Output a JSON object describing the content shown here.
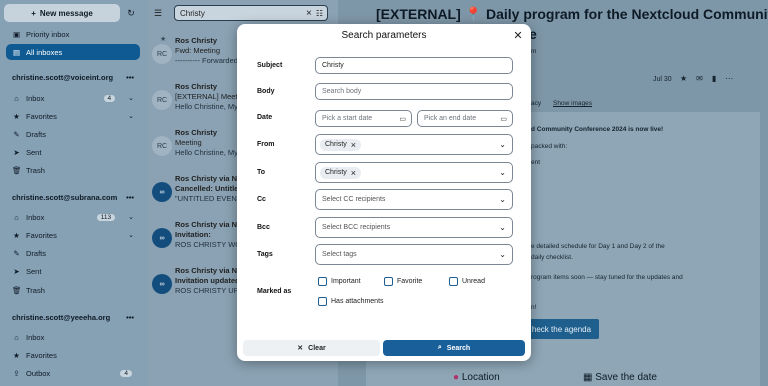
{
  "sidebar": {
    "new_message": "New message",
    "priority_inbox": "Priority inbox",
    "all_inboxes": "All inboxes",
    "accounts": [
      {
        "email": "christine.scott@voiceint.org",
        "folders": [
          {
            "label": "Inbox",
            "count": "4"
          },
          {
            "label": "Favorites"
          },
          {
            "label": "Drafts"
          },
          {
            "label": "Sent"
          },
          {
            "label": "Trash"
          }
        ]
      },
      {
        "email": "christine.scott@subrana.com",
        "folders": [
          {
            "label": "Inbox",
            "count": "113"
          },
          {
            "label": "Favorites"
          },
          {
            "label": "Drafts"
          },
          {
            "label": "Sent"
          },
          {
            "label": "Trash"
          }
        ]
      },
      {
        "email": "christine.scott@yeeeha.org",
        "folders": [
          {
            "label": "Inbox"
          },
          {
            "label": "Favorites"
          },
          {
            "label": "Outbox",
            "count": "4"
          }
        ]
      }
    ]
  },
  "message_list": {
    "search_value": "Christy",
    "messages": [
      {
        "from": "Ros Christy",
        "subject": "Fwd: Meeting",
        "preview": "---------- Forwarded",
        "avatar": "RC"
      },
      {
        "from": "Ros Christy",
        "subject": "[EXTERNAL] Meeting",
        "preview": "Hello Christine, My",
        "avatar": "RC"
      },
      {
        "from": "Ros Christy",
        "subject": "Meeting",
        "preview": "Hello Christine, My",
        "avatar": "RC"
      },
      {
        "from": "Ros Christy via Nex",
        "subject": "Cancelled: Untitled",
        "preview": "\"UNTITLED EVENT\"",
        "avatar": ""
      },
      {
        "from": "Ros Christy via Nex",
        "subject": "Invitation:",
        "preview": "ROS CHRISTY WOU",
        "avatar": ""
      },
      {
        "from": "Ros Christy via Nex",
        "subject": "Invitation updated",
        "preview": "ROS CHRISTY UPDA",
        "avatar": ""
      }
    ]
  },
  "reader": {
    "title_line1": "[EXTERNAL] 📍 Daily program for the Nextcloud Community",
    "title_line2": "e",
    "sender_fragment": "m",
    "date": "Jul 30",
    "privacy_fragment": "acy",
    "show_images": "Show images",
    "body_lines": [
      "d Community Conference 2024 is now live!",
      "packed with:",
      "ent",
      "e detailed schedule for Day 1 and Day 2 of the",
      "daily checklist.",
      "rogram items soon — stay tuned for the updates and",
      "n!"
    ],
    "agenda_button": "heck the agenda",
    "location": "Location",
    "save_the_date": "Save the date"
  },
  "modal": {
    "title": "Search parameters",
    "fields": {
      "subject_label": "Subject",
      "subject_value": "Christy",
      "body_label": "Body",
      "body_placeholder": "Search body",
      "date_label": "Date",
      "start_placeholder": "Pick a start date",
      "end_placeholder": "Pick an end date",
      "from_label": "From",
      "from_chip": "Christy",
      "to_label": "To",
      "to_chip": "Christy",
      "cc_label": "Cc",
      "cc_placeholder": "Select CC recipients",
      "bcc_label": "Bcc",
      "bcc_placeholder": "Select BCC recipients",
      "tags_label": "Tags",
      "tags_placeholder": "Select tags",
      "marked_label": "Marked as",
      "important": "Important",
      "favorite": "Favorite",
      "unread": "Unread",
      "has_attachments": "Has attachments"
    },
    "clear_button": "Clear",
    "search_button": "Search"
  },
  "colors": {
    "accent": "#195f9a",
    "overlay": "#6f8797"
  }
}
